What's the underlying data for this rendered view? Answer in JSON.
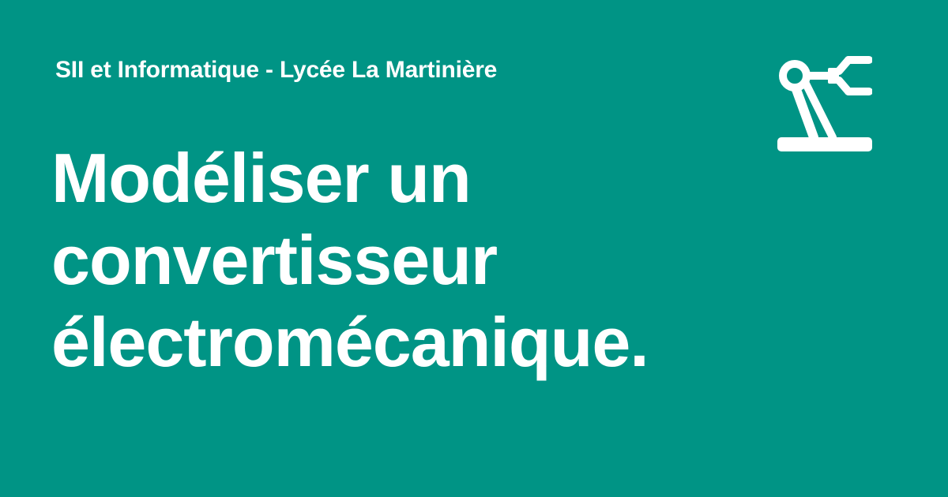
{
  "header": {
    "site_name": "SII et Informatique - Lycée La Martinière",
    "logo_icon": "robot-arm-icon"
  },
  "main": {
    "title_lines": [
      "Modéliser un",
      "convertisseur",
      "électromécanique."
    ]
  },
  "colors": {
    "background": "#009485",
    "foreground": "#ffffff"
  }
}
